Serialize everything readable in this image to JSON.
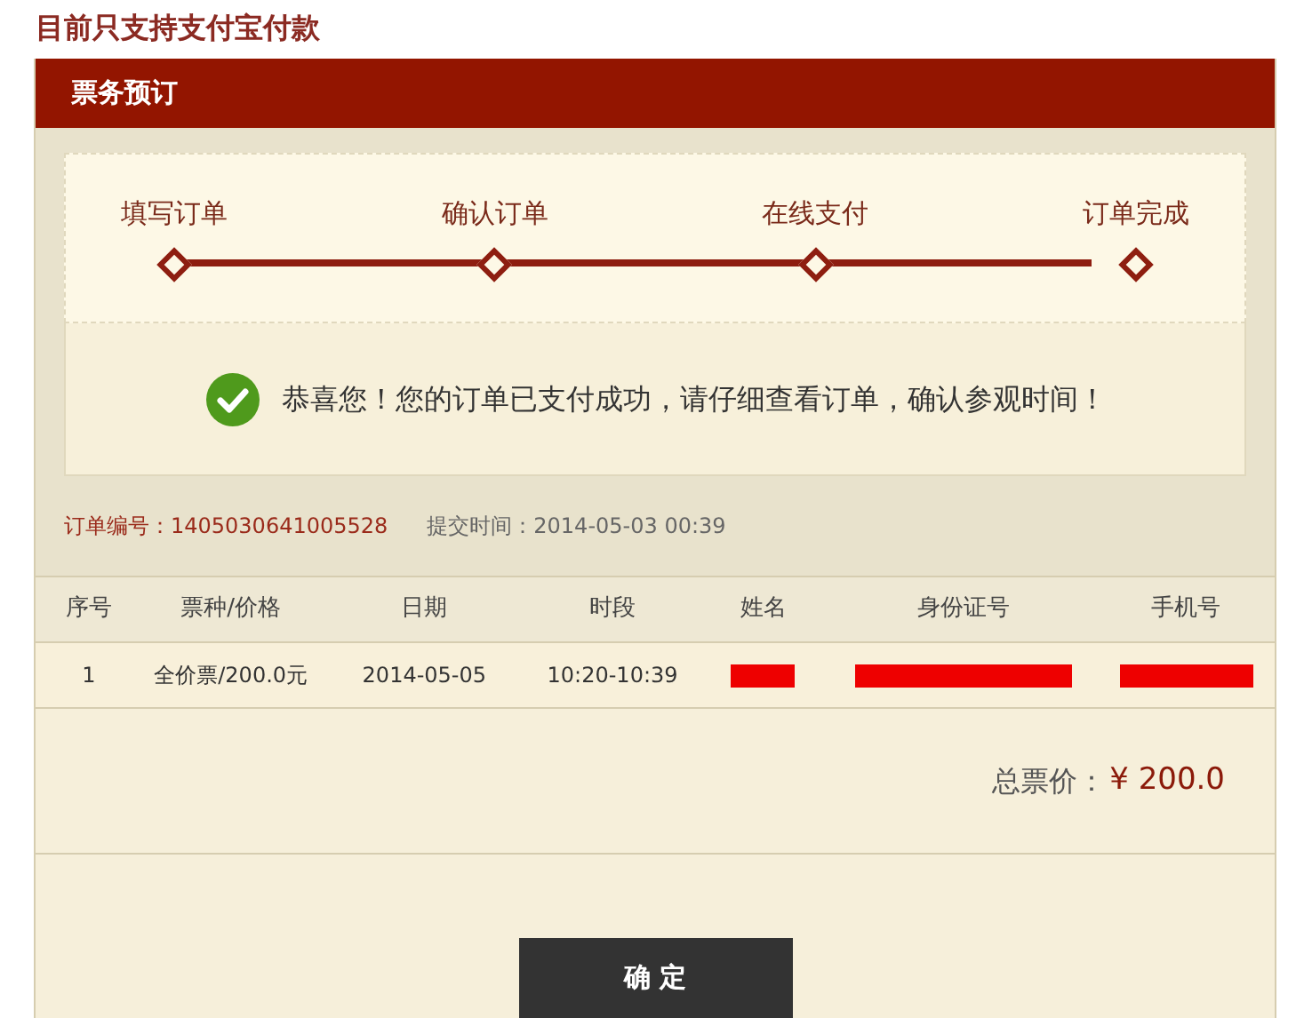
{
  "notice": "目前只支持支付宝付款",
  "panel": {
    "title": "票务预订"
  },
  "steps": [
    {
      "label": "填写订单"
    },
    {
      "label": "确认订单"
    },
    {
      "label": "在线支付"
    },
    {
      "label": "订单完成"
    }
  ],
  "message": "恭喜您！您的订单已支付成功，请仔细查看订单，确认参观时间！",
  "order": {
    "number": "订单编号：1405030641005528",
    "submitted": "提交时间：2014-05-03 00:39"
  },
  "table": {
    "columns": [
      "序号",
      "票种/价格",
      "日期",
      "时段",
      "姓名",
      "身份证号",
      "手机号"
    ],
    "rows": [
      {
        "cells": [
          {
            "kind": "text",
            "text": "1"
          },
          {
            "kind": "text",
            "text": "全价票/200.0元"
          },
          {
            "kind": "text",
            "text": "2014-05-05"
          },
          {
            "kind": "text",
            "text": "10:20-10:39"
          },
          {
            "kind": "redacted"
          },
          {
            "kind": "redacted"
          },
          {
            "kind": "redacted"
          }
        ]
      }
    ]
  },
  "total": {
    "label": "总票价：",
    "amount": "¥ 200.0"
  },
  "buttons": [
    "确 定"
  ]
}
